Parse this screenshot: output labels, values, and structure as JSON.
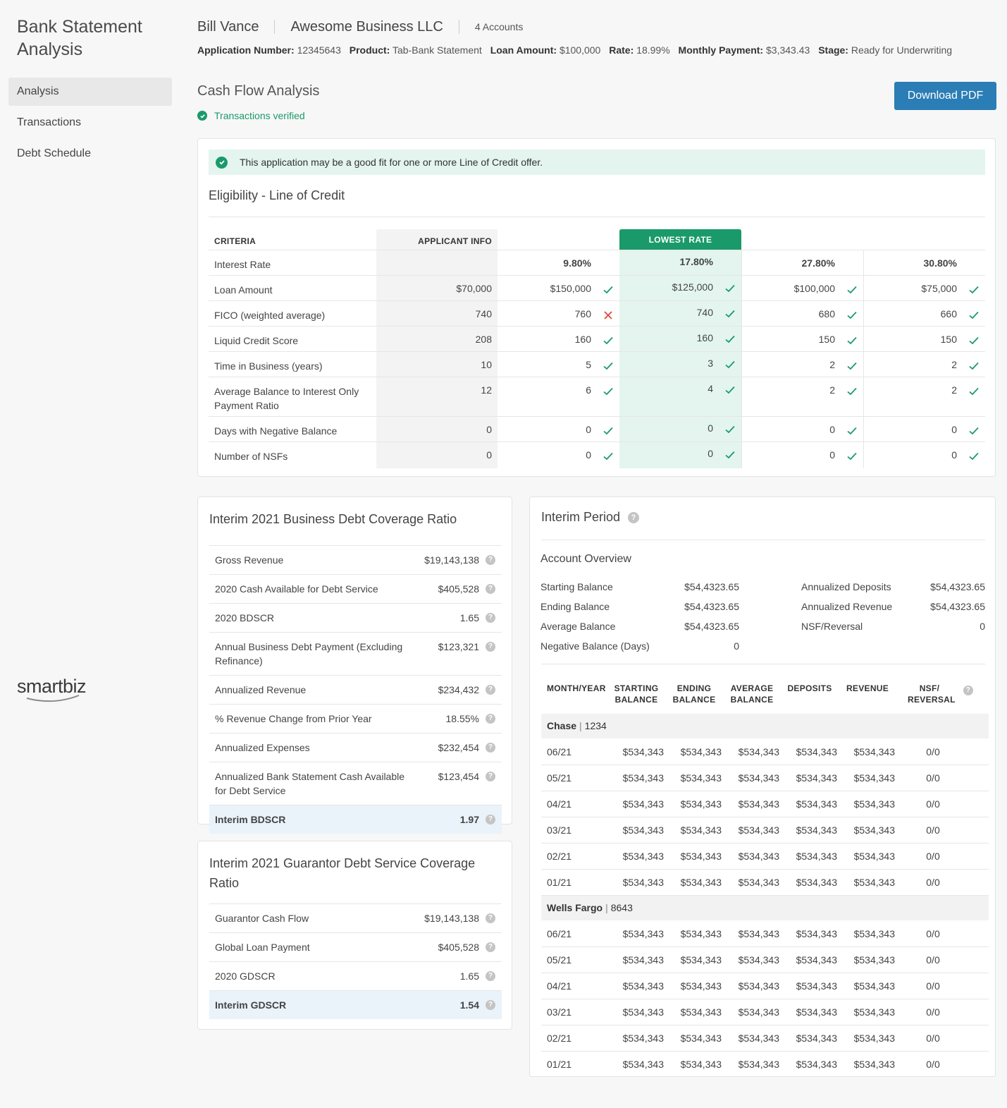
{
  "sidebar": {
    "app_title": "Bank Statement Analysis",
    "nav": [
      {
        "label": "Analysis",
        "active": true
      },
      {
        "label": "Transactions",
        "active": false
      },
      {
        "label": "Debt Schedule",
        "active": false
      }
    ],
    "logo_text": "smartbiz"
  },
  "header": {
    "applicant": "Bill Vance",
    "business": "Awesome Business LLC",
    "accounts": "4 Accounts",
    "meta": [
      {
        "label": "Application Number:",
        "value": "12345643"
      },
      {
        "label": "Product:",
        "value": "Tab-Bank Statement"
      },
      {
        "label": "Loan Amount:",
        "value": "$100,000"
      },
      {
        "label": "Rate:",
        "value": "18.99%"
      },
      {
        "label": "Monthly Payment:",
        "value": "$3,343.43"
      },
      {
        "label": "Stage:",
        "value": "Ready for Underwriting"
      }
    ]
  },
  "cashflow": {
    "title": "Cash Flow Analysis",
    "verified": "Transactions verified",
    "download_label": "Download PDF"
  },
  "eligibility": {
    "banner": "This application may be a good fit for one or more Line of Credit offer.",
    "title": "Eligibility - Line of Credit",
    "criteria_header": "CRITERIA",
    "applicant_header": "APPLICANT INFO",
    "lowest_rate_header": "LOWEST RATE",
    "rates": [
      "9.80%",
      "17.80%",
      "27.80%",
      "30.80%"
    ],
    "rows": [
      {
        "label": "Loan Amount",
        "applicant": "$70,000",
        "offers": [
          [
            "$150,000",
            "check"
          ],
          [
            "$125,000",
            "check"
          ],
          [
            "$100,000",
            "check"
          ],
          [
            "$75,000",
            "check"
          ]
        ]
      },
      {
        "label": "FICO (weighted average)",
        "applicant": "740",
        "offers": [
          [
            "760",
            "cross"
          ],
          [
            "740",
            "check"
          ],
          [
            "680",
            "check"
          ],
          [
            "660",
            "check"
          ]
        ]
      },
      {
        "label": "Liquid Credit Score",
        "applicant": "208",
        "offers": [
          [
            "160",
            "check"
          ],
          [
            "160",
            "check"
          ],
          [
            "150",
            "check"
          ],
          [
            "150",
            "check"
          ]
        ]
      },
      {
        "label": "Time in Business (years)",
        "applicant": "10",
        "offers": [
          [
            "5",
            "check"
          ],
          [
            "3",
            "check"
          ],
          [
            "2",
            "check"
          ],
          [
            "2",
            "check"
          ]
        ]
      },
      {
        "label": "Average Balance to Interest Only Payment Ratio",
        "applicant": "12",
        "offers": [
          [
            "6",
            "check"
          ],
          [
            "4",
            "check"
          ],
          [
            "2",
            "check"
          ],
          [
            "2",
            "check"
          ]
        ]
      },
      {
        "label": "Days with Negative Balance",
        "applicant": "0",
        "offers": [
          [
            "0",
            "check"
          ],
          [
            "0",
            "check"
          ],
          [
            "0",
            "check"
          ],
          [
            "0",
            "check"
          ]
        ]
      },
      {
        "label": "Number of NSFs",
        "applicant": "0",
        "offers": [
          [
            "0",
            "check"
          ],
          [
            "0",
            "check"
          ],
          [
            "0",
            "check"
          ],
          [
            "0",
            "check"
          ]
        ]
      }
    ],
    "interest_label": "Interest Rate"
  },
  "bdscr": {
    "title": "Interim 2021 Business Debt Coverage Ratio",
    "rows": [
      {
        "label": "Gross Revenue",
        "value": "$19,143,138"
      },
      {
        "label": "2020 Cash Available for Debt Service",
        "value": "$405,528"
      },
      {
        "label": "2020 BDSCR",
        "value": "1.65"
      },
      {
        "label": "Annual Business Debt Payment (Excluding Refinance)",
        "value": "$123,321"
      },
      {
        "label": "Annualized Revenue",
        "value": "$234,432"
      },
      {
        "label": "% Revenue Change from Prior Year",
        "value": "18.55%"
      },
      {
        "label": "Annualized Expenses",
        "value": "$232,454"
      },
      {
        "label": "Annualized Bank Statement Cash Available for Debt Service",
        "value": "$123,454"
      }
    ],
    "total": {
      "label": "Interim BDSCR",
      "value": "1.97"
    }
  },
  "gdscr": {
    "title": "Interim 2021 Guarantor Debt Service Coverage Ratio",
    "rows": [
      {
        "label": "Guarantor Cash Flow",
        "value": "$19,143,138"
      },
      {
        "label": "Global Loan Payment",
        "value": "$405,528"
      },
      {
        "label": "2020 GDSCR",
        "value": "1.65"
      }
    ],
    "total": {
      "label": "Interim GDSCR",
      "value": "1.54"
    }
  },
  "interim": {
    "title": "Interim Period",
    "overview_title": "Account Overview",
    "overview_left": [
      {
        "label": "Starting Balance",
        "value": "$54,4323.65"
      },
      {
        "label": "Ending Balance",
        "value": "$54,4323.65"
      },
      {
        "label": "Average Balance",
        "value": "$54,4323.65"
      },
      {
        "label": "Negative Balance (Days)",
        "value": "0"
      }
    ],
    "overview_right": [
      {
        "label": "Annualized Deposits",
        "value": "$54,4323.65"
      },
      {
        "label": "Annualized Revenue",
        "value": "$54,4323.65"
      },
      {
        "label": "NSF/Reversal",
        "value": "0"
      }
    ],
    "columns": [
      "MONTH/YEAR",
      "STARTING BALANCE",
      "ENDING BALANCE",
      "AVERAGE BALANCE",
      "DEPOSITS",
      "REVENUE",
      "NSF/ REVERSAL"
    ],
    "groups": [
      {
        "bank": "Chase",
        "acct": "1234",
        "rows": [
          [
            "06/21",
            "$534,343",
            "$534,343",
            "$534,343",
            "$534,343",
            "$534,343",
            "0/0"
          ],
          [
            "05/21",
            "$534,343",
            "$534,343",
            "$534,343",
            "$534,343",
            "$534,343",
            "0/0"
          ],
          [
            "04/21",
            "$534,343",
            "$534,343",
            "$534,343",
            "$534,343",
            "$534,343",
            "0/0"
          ],
          [
            "03/21",
            "$534,343",
            "$534,343",
            "$534,343",
            "$534,343",
            "$534,343",
            "0/0"
          ],
          [
            "02/21",
            "$534,343",
            "$534,343",
            "$534,343",
            "$534,343",
            "$534,343",
            "0/0"
          ],
          [
            "01/21",
            "$534,343",
            "$534,343",
            "$534,343",
            "$534,343",
            "$534,343",
            "0/0"
          ]
        ]
      },
      {
        "bank": "Wells Fargo",
        "acct": "8643",
        "rows": [
          [
            "06/21",
            "$534,343",
            "$534,343",
            "$534,343",
            "$534,343",
            "$534,343",
            "0/0"
          ],
          [
            "05/21",
            "$534,343",
            "$534,343",
            "$534,343",
            "$534,343",
            "$534,343",
            "0/0"
          ],
          [
            "04/21",
            "$534,343",
            "$534,343",
            "$534,343",
            "$534,343",
            "$534,343",
            "0/0"
          ],
          [
            "03/21",
            "$534,343",
            "$534,343",
            "$534,343",
            "$534,343",
            "$534,343",
            "0/0"
          ],
          [
            "02/21",
            "$534,343",
            "$534,343",
            "$534,343",
            "$534,343",
            "$534,343",
            "0/0"
          ],
          [
            "01/21",
            "$534,343",
            "$534,343",
            "$534,343",
            "$534,343",
            "$534,343",
            "0/0"
          ]
        ]
      }
    ]
  },
  "colors": {
    "accent_green": "#1a9a6a",
    "button_blue": "#2b7db5",
    "fail_red": "#e0453a"
  }
}
